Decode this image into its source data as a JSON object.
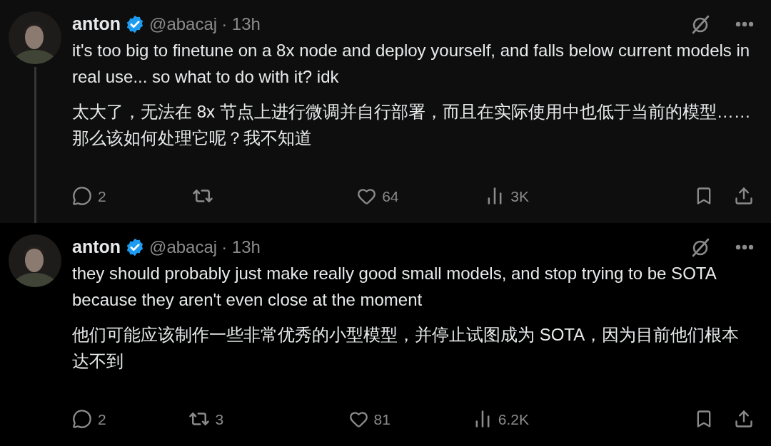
{
  "tweets": [
    {
      "name": "anton",
      "verified": true,
      "handle": "@abacaj",
      "time": "· 13h",
      "connected": true,
      "text": "it's too big to finetune on a 8x node and deploy yourself, and falls below current models in real use... so what to do with it? idk",
      "translation": "太大了，无法在 8x 节点上进行微调并自行部署，而且在实际使用中也低于当前的模型…… 那么该如何处理它呢？我不知道",
      "replies": "2",
      "likes": "64",
      "views": "3K"
    },
    {
      "name": "anton",
      "verified": true,
      "handle": "@abacaj",
      "time": "· 13h",
      "connected": false,
      "text": "they should probably just make really good small models, and stop trying to be SOTA because they aren't even close at the moment",
      "translation": "他们可能应该制作一些非常优秀的小型模型，并停止试图成为 SOTA，因为目前他们根本达不到",
      "replies": "2",
      "reposts": "3",
      "likes": "81",
      "views": "6.2K"
    }
  ]
}
